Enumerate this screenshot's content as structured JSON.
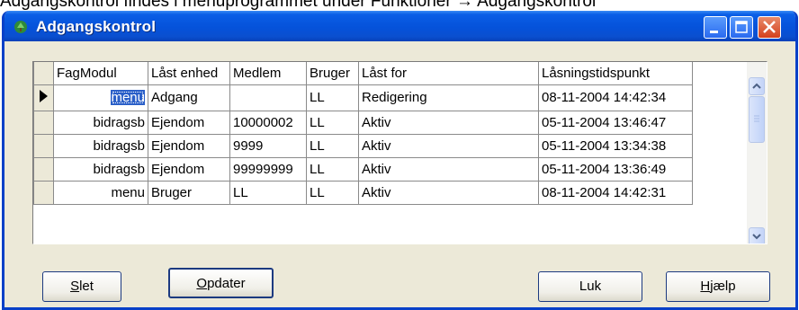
{
  "doc_text": "Adgangskontrol findes i menuprogrammet under Funktioner → Adgangskontrol",
  "window": {
    "title": "Adgangskontrol",
    "icons": [
      "app-icon",
      "minimize-icon",
      "maximize-icon",
      "close-icon"
    ]
  },
  "grid": {
    "columns": [
      "FagModul",
      "Låst enhed",
      "Medlem",
      "Bruger",
      "Låst for",
      "Låsningstidspunkt"
    ],
    "rows": [
      {
        "fagmodul": "menu",
        "enhed": "Adgang",
        "medlem": "",
        "bruger": "LL",
        "laast_for": "Redigering",
        "tidspunkt": "08-11-2004 14:42:34",
        "current": true
      },
      {
        "fagmodul": "bidragsb",
        "enhed": "Ejendom",
        "medlem": "10000002",
        "bruger": "LL",
        "laast_for": "Aktiv",
        "tidspunkt": "05-11-2004 13:46:47"
      },
      {
        "fagmodul": "bidragsb",
        "enhed": "Ejendom",
        "medlem": "9999",
        "bruger": "LL",
        "laast_for": "Aktiv",
        "tidspunkt": "05-11-2004 13:34:38"
      },
      {
        "fagmodul": "bidragsb",
        "enhed": "Ejendom",
        "medlem": "99999999",
        "bruger": "LL",
        "laast_for": "Aktiv",
        "tidspunkt": "05-11-2004 13:36:49"
      },
      {
        "fagmodul": "menu",
        "enhed": "Bruger",
        "medlem": "LL",
        "bruger": "LL",
        "laast_for": "Aktiv",
        "tidspunkt": "08-11-2004 14:42:31"
      }
    ],
    "scrollbar_icons": [
      "scroll-up-icon",
      "scroll-down-icon"
    ]
  },
  "buttons": {
    "slet": {
      "first": "S",
      "rest": "let"
    },
    "opdater": {
      "first": "O",
      "rest": "pdater"
    },
    "luk": "Luk",
    "hjaelp": {
      "first": "H",
      "rest": "jælp"
    }
  },
  "colors": {
    "titlebar": "#0552da",
    "selection": "#2a5fc8",
    "face": "#ece9d8"
  }
}
